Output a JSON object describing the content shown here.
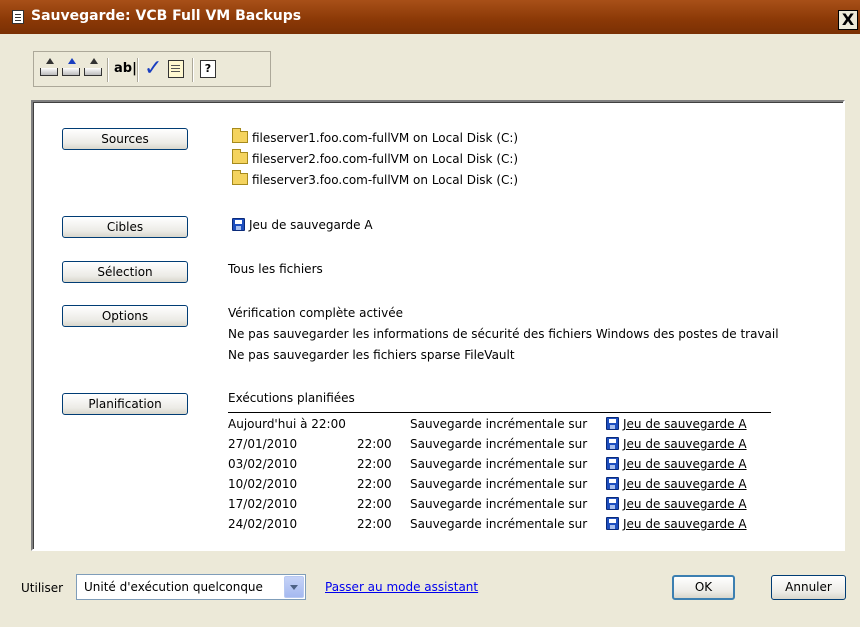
{
  "window": {
    "title": "Sauvegarde: VCB Full VM Backups",
    "close_label": "X"
  },
  "toolbar": {
    "ab_label": "ab|",
    "check_glyph": "✓",
    "help_glyph": "?"
  },
  "sections": {
    "sources": {
      "button": "Sources",
      "items": [
        "fileserver1.foo.com-fullVM on Local Disk (C:)",
        "fileserver2.foo.com-fullVM on Local Disk (C:)",
        "fileserver3.foo.com-fullVM on Local Disk (C:)"
      ]
    },
    "targets": {
      "button": "Cibles",
      "item": "Jeu de sauvegarde A"
    },
    "selection": {
      "button": "Sélection",
      "value": "Tous les fichiers"
    },
    "options": {
      "button": "Options",
      "lines": [
        "Vérification complète activée",
        "Ne pas sauvegarder les informations de sécurité des fichiers Windows des postes de travail",
        "Ne pas sauvegarder les fichiers sparse FileVault"
      ]
    },
    "schedule": {
      "button": "Planification",
      "heading": "Exécutions planifiées",
      "rows": [
        {
          "date": "Aujourd'hui à 22:00",
          "time": "",
          "action": "Sauvegarde incrémentale sur",
          "target": "Jeu de sauvegarde A"
        },
        {
          "date": "27/01/2010",
          "time": "22:00",
          "action": "Sauvegarde incrémentale sur",
          "target": "Jeu de sauvegarde A"
        },
        {
          "date": "03/02/2010",
          "time": "22:00",
          "action": "Sauvegarde incrémentale sur",
          "target": "Jeu de sauvegarde A"
        },
        {
          "date": "10/02/2010",
          "time": "22:00",
          "action": "Sauvegarde incrémentale sur",
          "target": "Jeu de sauvegarde A"
        },
        {
          "date": "17/02/2010",
          "time": "22:00",
          "action": "Sauvegarde incrémentale sur",
          "target": "Jeu de sauvegarde A"
        },
        {
          "date": "24/02/2010",
          "time": "22:00",
          "action": "Sauvegarde incrémentale sur",
          "target": "Jeu de sauvegarde A"
        }
      ]
    }
  },
  "footer": {
    "use_label": "Utiliser",
    "executor_selected": "Unité d'exécution quelconque",
    "wizard_link": "Passer au mode assistant",
    "ok": "OK",
    "cancel": "Annuler"
  },
  "colors": {
    "titlebar": "#8a3806",
    "link": "#0000ee",
    "disk": "#1e4fbf",
    "folder": "#f4d35e"
  }
}
